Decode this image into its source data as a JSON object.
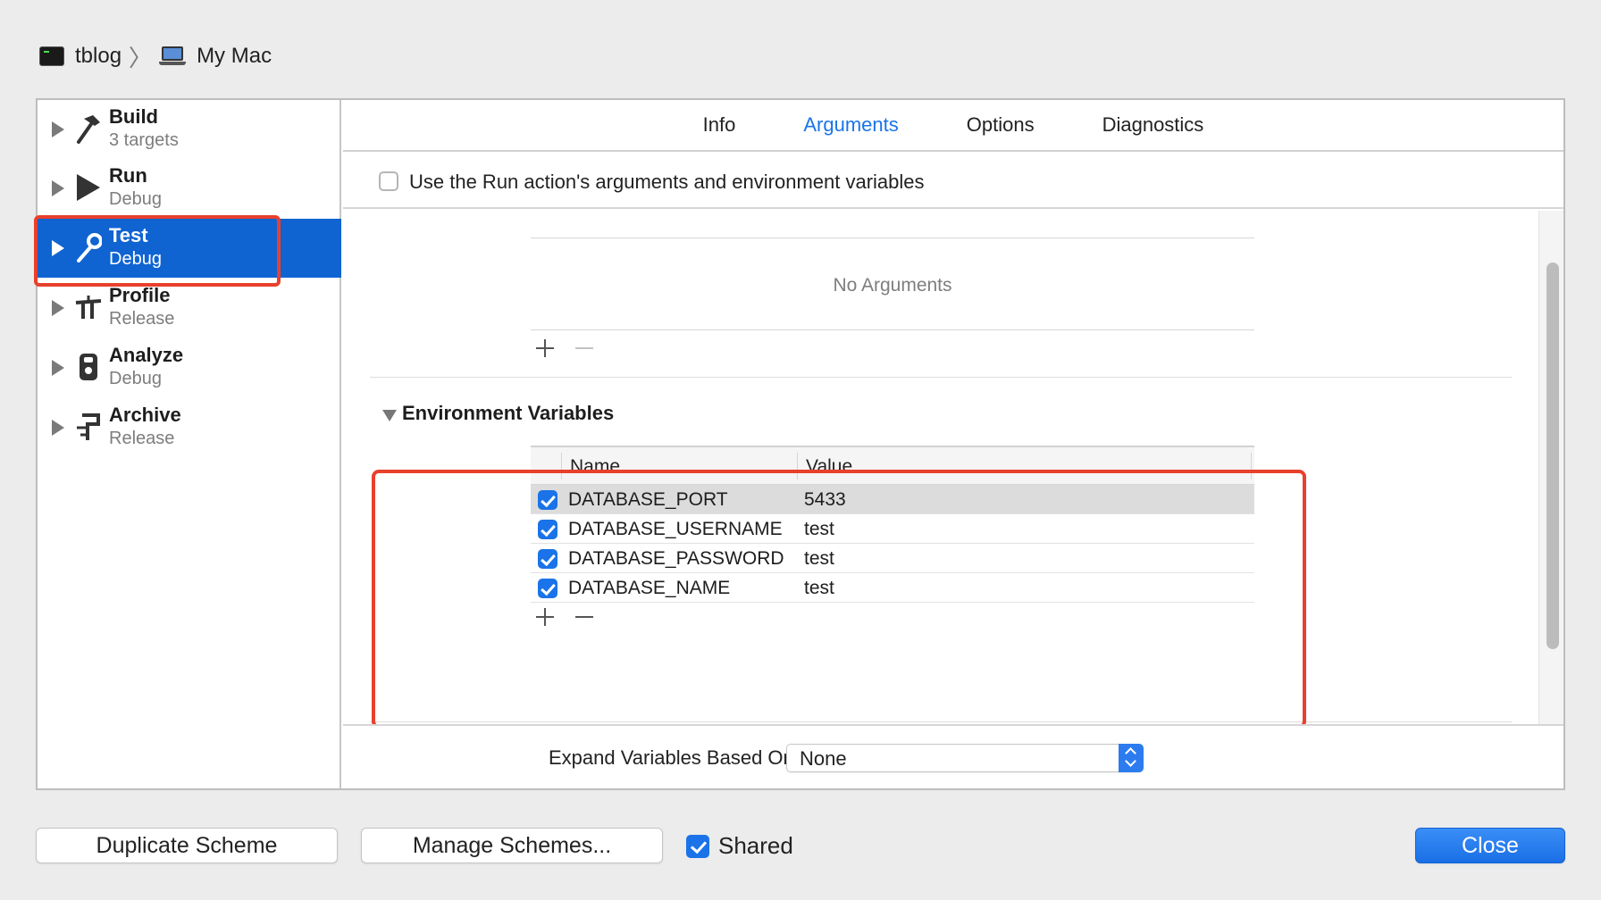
{
  "breadcrumb": {
    "project": "tblog",
    "destination": "My Mac"
  },
  "sidebar": {
    "items": [
      {
        "title": "Build",
        "subtitle": "3 targets",
        "icon": "hammer-icon"
      },
      {
        "title": "Run",
        "subtitle": "Debug",
        "icon": "play-icon"
      },
      {
        "title": "Test",
        "subtitle": "Debug",
        "icon": "wrench-icon",
        "selected": true
      },
      {
        "title": "Profile",
        "subtitle": "Release",
        "icon": "instruments-icon"
      },
      {
        "title": "Analyze",
        "subtitle": "Debug",
        "icon": "analyze-icon"
      },
      {
        "title": "Archive",
        "subtitle": "Release",
        "icon": "archive-icon"
      }
    ]
  },
  "tabs": [
    {
      "label": "Info"
    },
    {
      "label": "Arguments",
      "active": true
    },
    {
      "label": "Options"
    },
    {
      "label": "Diagnostics"
    }
  ],
  "arguments": {
    "use_run_label": "Use the Run action's arguments and environment variables",
    "use_run_checked": false,
    "empty_label": "No Arguments"
  },
  "env": {
    "heading": "Environment Variables",
    "col_name": "Name",
    "col_value": "Value",
    "rows": [
      {
        "name": "DATABASE_PORT",
        "value": "5433",
        "enabled": true
      },
      {
        "name": "DATABASE_USERNAME",
        "value": "test",
        "enabled": true
      },
      {
        "name": "DATABASE_PASSWORD",
        "value": "test",
        "enabled": true
      },
      {
        "name": "DATABASE_NAME",
        "value": "test",
        "enabled": true
      }
    ]
  },
  "expand": {
    "label": "Expand Variables Based On",
    "value": "None"
  },
  "footer": {
    "duplicate_label": "Duplicate Scheme",
    "manage_label": "Manage Schemes...",
    "shared_label": "Shared",
    "shared_checked": true,
    "close_label": "Close"
  },
  "colors": {
    "accent": "#0f64d2",
    "highlight": "#e8402c",
    "tab_active": "#1a74e8"
  }
}
